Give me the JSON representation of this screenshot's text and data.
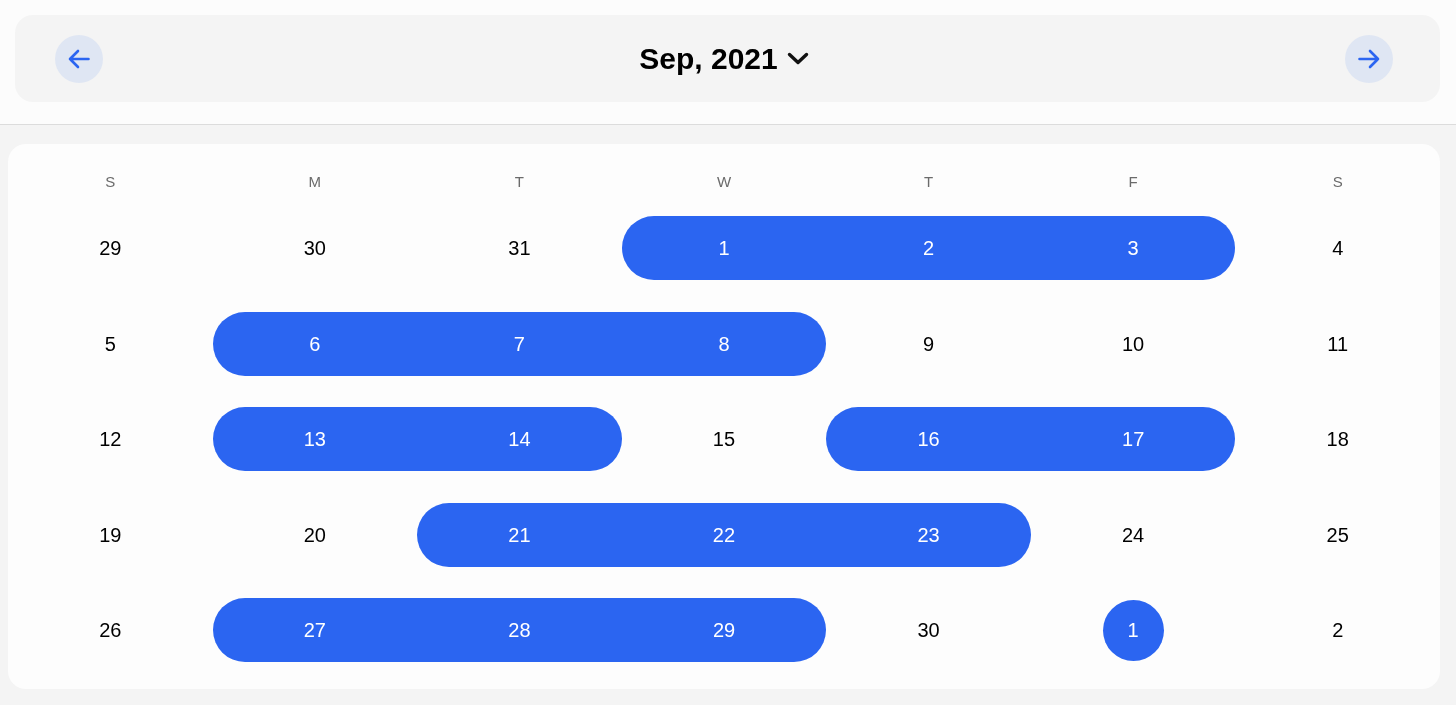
{
  "header": {
    "title": "Sep, 2021"
  },
  "weekdays": [
    "S",
    "M",
    "T",
    "W",
    "T",
    "F",
    "S"
  ],
  "weeks": [
    {
      "days": [
        {
          "label": "29",
          "selected": false
        },
        {
          "label": "30",
          "selected": false
        },
        {
          "label": "31",
          "selected": false
        },
        {
          "label": "1",
          "selected": true
        },
        {
          "label": "2",
          "selected": true
        },
        {
          "label": "3",
          "selected": true
        },
        {
          "label": "4",
          "selected": false
        }
      ]
    },
    {
      "days": [
        {
          "label": "5",
          "selected": false
        },
        {
          "label": "6",
          "selected": true
        },
        {
          "label": "7",
          "selected": true
        },
        {
          "label": "8",
          "selected": true
        },
        {
          "label": "9",
          "selected": false
        },
        {
          "label": "10",
          "selected": false
        },
        {
          "label": "11",
          "selected": false
        }
      ]
    },
    {
      "days": [
        {
          "label": "12",
          "selected": false
        },
        {
          "label": "13",
          "selected": true
        },
        {
          "label": "14",
          "selected": true
        },
        {
          "label": "15",
          "selected": false
        },
        {
          "label": "16",
          "selected": true
        },
        {
          "label": "17",
          "selected": true
        },
        {
          "label": "18",
          "selected": false
        }
      ]
    },
    {
      "days": [
        {
          "label": "19",
          "selected": false
        },
        {
          "label": "20",
          "selected": false
        },
        {
          "label": "21",
          "selected": true
        },
        {
          "label": "22",
          "selected": true
        },
        {
          "label": "23",
          "selected": true
        },
        {
          "label": "24",
          "selected": false
        },
        {
          "label": "25",
          "selected": false
        }
      ]
    },
    {
      "days": [
        {
          "label": "26",
          "selected": false
        },
        {
          "label": "27",
          "selected": true
        },
        {
          "label": "28",
          "selected": true
        },
        {
          "label": "29",
          "selected": true
        },
        {
          "label": "30",
          "selected": false
        },
        {
          "label": "1",
          "selected": true
        },
        {
          "label": "2",
          "selected": false
        }
      ]
    }
  ]
}
